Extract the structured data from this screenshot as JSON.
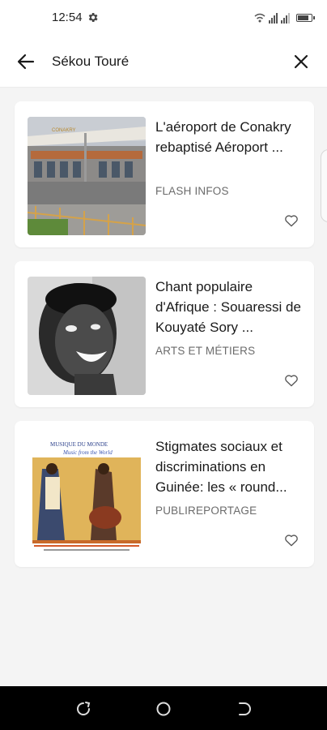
{
  "status_bar": {
    "time": "12:54",
    "icons": [
      "gear-icon",
      "wifi-icon",
      "signal-icon",
      "battery-icon"
    ]
  },
  "search": {
    "value": "Sékou Touré",
    "back_icon": "arrow-left-icon",
    "clear_icon": "close-icon"
  },
  "results": [
    {
      "title": "L'aéroport de Conakry rebaptisé Aéroport ...",
      "category": "FLASH INFOS",
      "thumb": "airport-terminal-photo",
      "thumb_label": "CONAKRY",
      "favorite_icon": "heart-outline-icon"
    },
    {
      "title": "Chant populaire d'Afrique : Souaressi de Kouyaté Sory ...",
      "category": "ARTS ET MÉTIERS",
      "thumb": "smiling-man-bw-photo",
      "favorite_icon": "heart-outline-icon"
    },
    {
      "title": "Stigmates sociaux et discriminations en Guinée: les « round...",
      "category": "PUBLIREPORTAGE",
      "thumb": "album-cover-musique-du-monde",
      "thumb_label": "MUSIQUE DU MONDE",
      "thumb_sublabel": "Music from the World",
      "favorite_icon": "heart-outline-icon"
    }
  ],
  "nav_bar": {
    "buttons": [
      "recent-apps-icon",
      "home-icon",
      "back-gesture-icon"
    ]
  },
  "colors": {
    "background": "#f4f4f4",
    "card": "#ffffff",
    "category_text": "#6b6b6b"
  }
}
